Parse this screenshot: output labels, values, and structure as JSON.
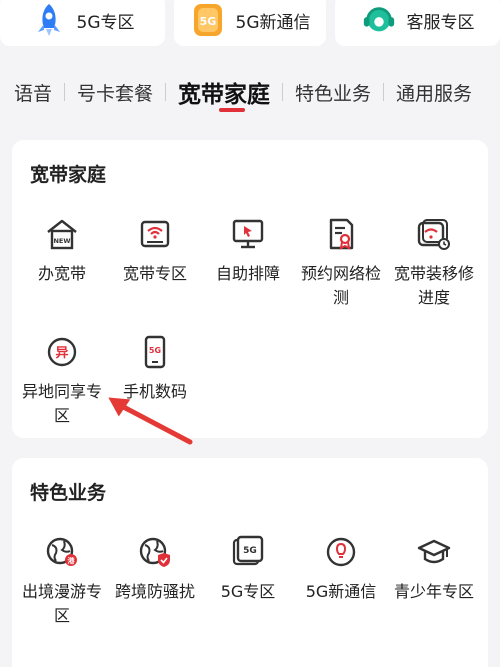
{
  "quick_cards": [
    {
      "label": "5G专区",
      "icon": "rocket-icon"
    },
    {
      "label": "5G新通信",
      "icon": "5g-badge-icon",
      "badge": "5G"
    },
    {
      "label": "客服专区",
      "icon": "headset-icon"
    }
  ],
  "tabs": [
    {
      "label": "语音"
    },
    {
      "label": "号卡套餐"
    },
    {
      "label": "宽带家庭",
      "active": true
    },
    {
      "label": "特色业务"
    },
    {
      "label": "通用服务"
    }
  ],
  "broadband": {
    "title": "宽带家庭",
    "items": [
      {
        "label": "办宽带",
        "icon": "new-house-icon",
        "badge": "NEW"
      },
      {
        "label": "宽带专区",
        "icon": "router-icon"
      },
      {
        "label": "自助排障",
        "icon": "monitor-cursor-icon"
      },
      {
        "label": "预约网络检测",
        "icon": "certificate-icon"
      },
      {
        "label": "宽带装移修进度",
        "icon": "wifi-clock-icon"
      },
      {
        "label": "异地同享专区",
        "icon": "yi-circle-icon",
        "badge": "异"
      },
      {
        "label": "手机数码",
        "icon": "phone-5g-icon",
        "badge": "5G"
      }
    ]
  },
  "special": {
    "title": "特色业务",
    "items": [
      {
        "label": "出境漫游专区",
        "icon": "globe-roaming-icon"
      },
      {
        "label": "跨境防骚扰",
        "icon": "globe-shield-icon"
      },
      {
        "label": "5G专区",
        "icon": "5g-square-icon",
        "badge": "5G"
      },
      {
        "label": "5G新通信",
        "icon": "lightbulb-icon"
      },
      {
        "label": "青少年专区",
        "icon": "graduation-cap-icon"
      }
    ]
  },
  "colors": {
    "accent": "#e0303a",
    "blue": "#2f7df6",
    "orange": "#f7a52b",
    "teal": "#1fbf9c"
  }
}
